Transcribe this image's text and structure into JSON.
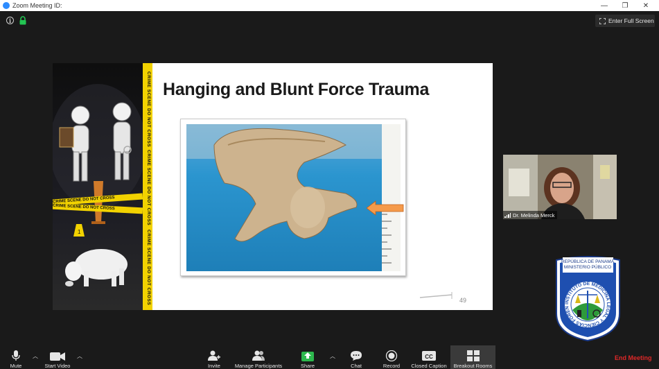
{
  "window": {
    "title": "Zoom Meeting ID:",
    "minimize": "—",
    "restore": "❐",
    "close": "✕"
  },
  "topbar": {
    "info_glyph": "i",
    "fullscreen_label": "Enter Full Screen"
  },
  "slide": {
    "title": "Hanging and Blunt Force Trauma",
    "page_number": "49",
    "tape_text": "CRIME SCENE DO NOT CROSS",
    "evidence_marker": "1"
  },
  "participant": {
    "name": "Dr. Melinda Merck"
  },
  "seal": {
    "line1": "REPÚBLICA DE PANAMÁ",
    "line2": "MINISTERIO PÚBLICO",
    "ring_text": "INSTITUTO DE MEDICINA LEGAL Y CIENCIAS FORENSES"
  },
  "toolbar": {
    "mute": "Mute",
    "start_video": "Start Video",
    "invite": "Invite",
    "manage_participants": "Manage Participants",
    "share": "Share",
    "chat": "Chat",
    "record": "Record",
    "closed_caption": "Closed Caption",
    "breakout_rooms": "Breakout Rooms",
    "end_meeting": "End Meeting",
    "cc_glyph": "CC"
  },
  "colors": {
    "share_green": "#2db84d",
    "end_red": "#e02828",
    "tape_yellow": "#f2d200",
    "arrow_orange": "#f59a4a"
  }
}
